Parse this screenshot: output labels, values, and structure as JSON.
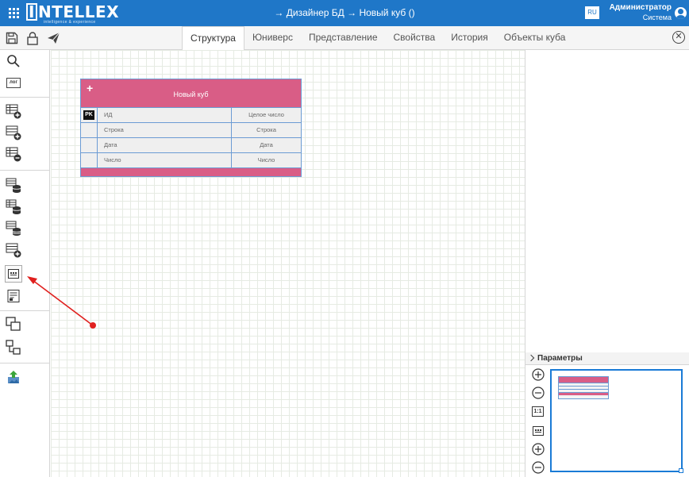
{
  "header": {
    "logo": "INTELLEX",
    "logo_sub": "intelligence & experience",
    "breadcrumb": [
      "Дизайнер БД",
      "Новый куб ()"
    ],
    "lang": "RU",
    "user_name": "Администратор",
    "user_role": "Система",
    "bg_color": "#1f77c8"
  },
  "toolbar": {
    "icons": [
      "save-icon",
      "lock-icon",
      "send-icon"
    ],
    "tabs": [
      "Структура",
      "Юниверс",
      "Представление",
      "Свойства",
      "История",
      "Объекты куба"
    ],
    "active_tab": "Структура"
  },
  "left_tools": {
    "log_label": "лог",
    "icons": [
      "search-icon",
      "log-icon",
      "add-table-icon",
      "add-table-icon",
      "remove-table-icon",
      "database-icon",
      "database-icon",
      "database-icon",
      "add-database-icon",
      "grid-view-icon",
      "properties-icon",
      "copy-icon",
      "hierarchy-icon",
      "upload-image-icon"
    ]
  },
  "cube": {
    "plus": "+",
    "title": "Новый куб",
    "header_color": "#d95d86",
    "rows": [
      {
        "key": "PK",
        "name": "ИД",
        "type": "Целое число"
      },
      {
        "key": "",
        "name": "Строка",
        "type": "Строка"
      },
      {
        "key": "",
        "name": "Дата",
        "type": "Дата"
      },
      {
        "key": "",
        "name": "Число",
        "type": "Число"
      }
    ]
  },
  "right_panel": {
    "params_label": "Параметры",
    "zoom_icons": [
      "zoom-in-icon",
      "zoom-out-icon",
      "actual-size-icon",
      "grid-view-icon",
      "zoom-in-icon",
      "zoom-out-icon"
    ],
    "actual_size_label": "1:1"
  }
}
